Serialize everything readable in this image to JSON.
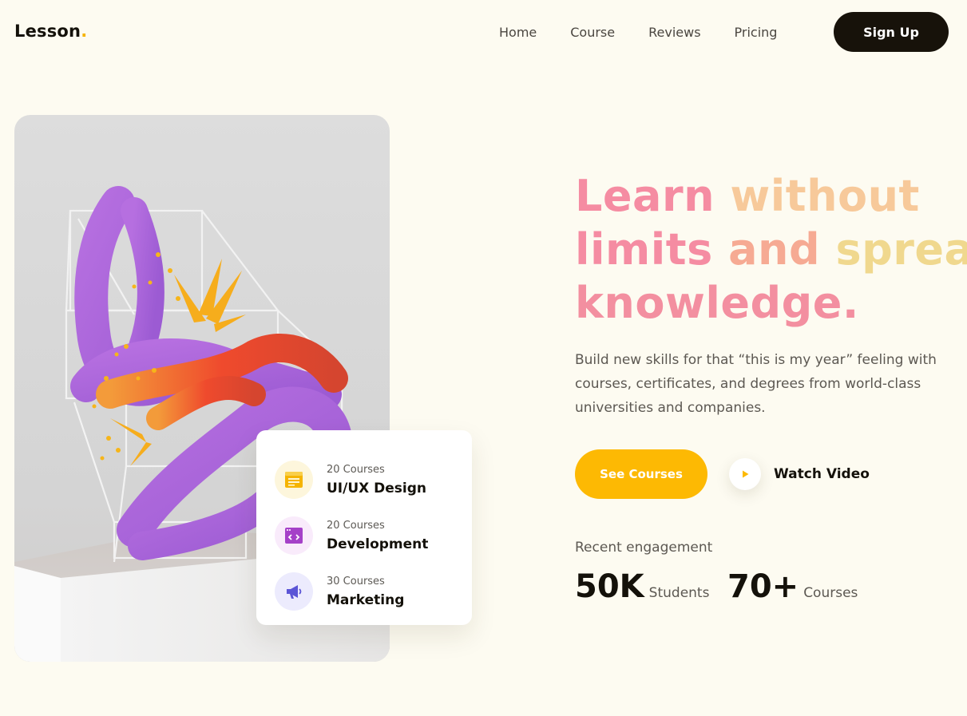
{
  "brand": {
    "name": "Lesson",
    "dot": ".",
    "dot_color": "#f5b400"
  },
  "nav": {
    "items": [
      "Home",
      "Course",
      "Reviews",
      "Pricing"
    ],
    "signup_label": "Sign Up"
  },
  "hero": {
    "headline": {
      "line1a": "Learn",
      "line1b": "without",
      "line2a": "limits",
      "line2b": "and",
      "line2c": "spread",
      "line3": "knowledge."
    },
    "subtext": "Build new skills for that “this is my year” feeling with courses, certificates, and degrees from world-class universities and companies.",
    "cta_primary": "See Courses",
    "cta_secondary": "Watch Video",
    "engagement_label": "Recent engagement",
    "stats": [
      {
        "value": "50K",
        "unit": "Students"
      },
      {
        "value": "70+",
        "unit": "Courses"
      }
    ]
  },
  "categories": [
    {
      "count": "20 Courses",
      "name": "UI/UX Design",
      "icon": "layout-icon",
      "color": "#f5b400",
      "bg": "#fdf6dc"
    },
    {
      "count": "20 Courses",
      "name": "Development",
      "icon": "code-window-icon",
      "color": "#a541c8",
      "bg": "#f9ebfb"
    },
    {
      "count": "30 Courses",
      "name": "Marketing",
      "icon": "megaphone-icon",
      "color": "#5b55d6",
      "bg": "#ecebfd"
    }
  ],
  "colors": {
    "accent": "#fdb903",
    "dark": "#17120a",
    "background": "#fdfbf1"
  }
}
